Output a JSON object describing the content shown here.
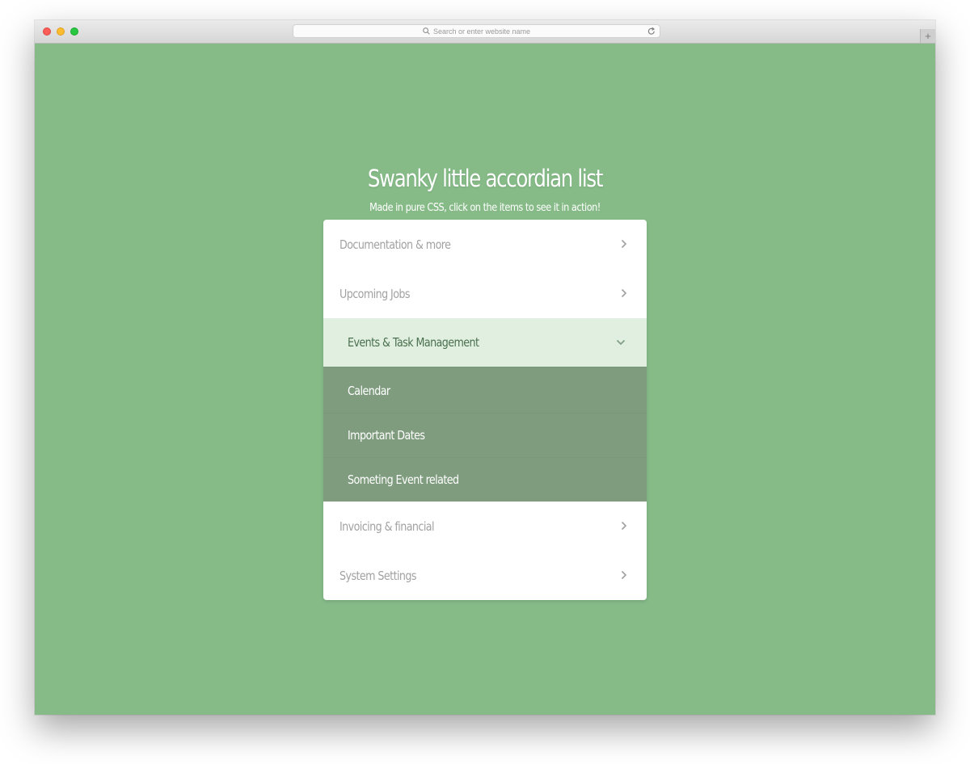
{
  "browser": {
    "address_placeholder": "Search or enter website name",
    "icons": {
      "search": "search-icon",
      "reload": "reload-icon",
      "new_tab": "plus-icon"
    }
  },
  "page": {
    "title": "Swanky little accordian list",
    "subtitle": "Made in pure CSS, click on the items to see it in action!"
  },
  "accordion": {
    "items": [
      {
        "label": "Documentation & more"
      },
      {
        "label": "Upcoming Jobs"
      },
      {
        "label": "Events & Task Management",
        "expanded": true,
        "children": [
          {
            "label": "Calendar"
          },
          {
            "label": "Important Dates"
          },
          {
            "label": "Someting Event related"
          }
        ]
      },
      {
        "label": "Invoicing & financial"
      },
      {
        "label": "System Settings"
      }
    ]
  },
  "colors": {
    "page_background": "#86bb88",
    "active_item_background": "#e0efe0",
    "submenu_background": "#7f9c7f",
    "item_text": "#a2a2a2",
    "active_text": "#4b704f"
  }
}
